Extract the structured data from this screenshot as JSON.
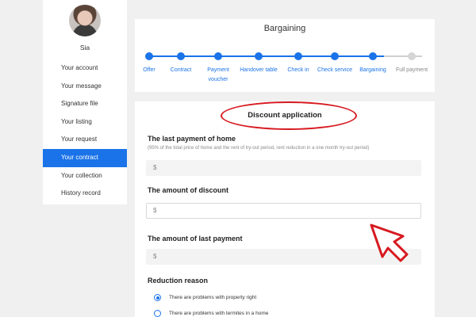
{
  "sidebar": {
    "user_name": "Sia",
    "items": [
      {
        "label": "Your account"
      },
      {
        "label": "Your message"
      },
      {
        "label": "Signature file"
      },
      {
        "label": "Your listing"
      },
      {
        "label": "Your request"
      },
      {
        "label": "Your contract",
        "active": true
      },
      {
        "label": "Your collection"
      },
      {
        "label": "History record"
      }
    ]
  },
  "progress": {
    "title": "Bargaining",
    "steps": [
      {
        "label": "Offer",
        "done": true
      },
      {
        "label": "Contract",
        "done": true
      },
      {
        "label": "Payment voucher",
        "done": true
      },
      {
        "label": "Handover table",
        "done": true
      },
      {
        "label": "Check in",
        "done": true
      },
      {
        "label": "Check service",
        "done": true
      },
      {
        "label": "Bargaining",
        "done": true
      },
      {
        "label": "Full payment",
        "done": false
      }
    ]
  },
  "form": {
    "heading": "Discount application",
    "last_payment": {
      "label": "The last payment of home",
      "hint": "(95% of the total price of home and the rent of try-out period, rent reduction in a one month try-out period)",
      "placeholder": "$"
    },
    "discount": {
      "label": "The amount of discount",
      "placeholder": "$"
    },
    "last_amount": {
      "label": "The amount of last payment",
      "placeholder": "$"
    },
    "reduction": {
      "label": "Reduction reason",
      "options": [
        {
          "label": "There are problems with property right",
          "checked": true
        },
        {
          "label": "There are problems with termites in a home",
          "checked": false
        }
      ]
    }
  },
  "colors": {
    "accent": "#1a73e8",
    "annotation": "#d71920"
  }
}
